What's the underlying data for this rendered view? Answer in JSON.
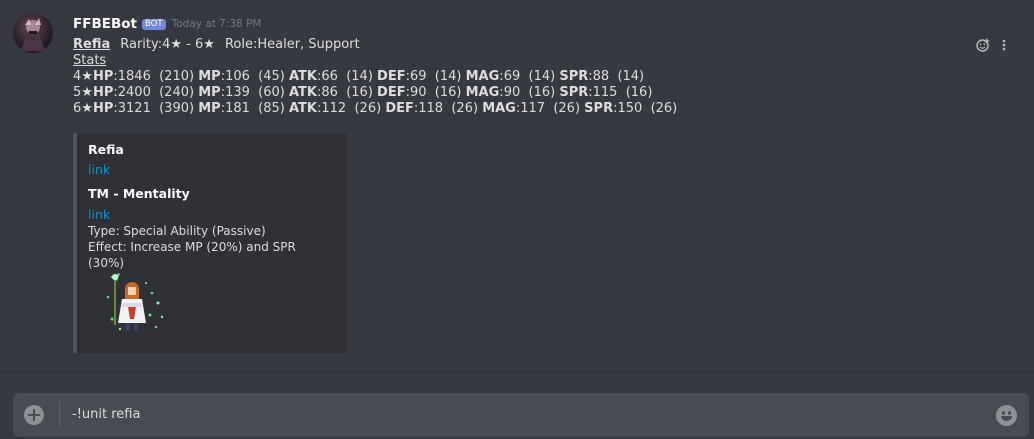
{
  "message": {
    "username": "FFBEBot",
    "bot_tag": "BOT",
    "timestamp": "Today at 7:38 PM",
    "unit_name": "Refia",
    "rarity_text": "Rarity:4★ - 6★",
    "role_text": "Role:Healer, Support",
    "stats_label": "Stats",
    "stats_rows": [
      {
        "prefix": "4★",
        "hp": "1846",
        "hp_b": "(210)",
        "mp": "106",
        "mp_b": "(45)",
        "atk": "66",
        "atk_b": "(14)",
        "def": "69",
        "def_b": "(14)",
        "mag": "69",
        "mag_b": "(14)",
        "spr": "88",
        "spr_b": "(14)"
      },
      {
        "prefix": "5★",
        "hp": "2400",
        "hp_b": "(240)",
        "mp": "139",
        "mp_b": "(60)",
        "atk": "86",
        "atk_b": "(16)",
        "def": "90",
        "def_b": "(16)",
        "mag": "90",
        "mag_b": "(16)",
        "spr": "115",
        "spr_b": "(16)"
      },
      {
        "prefix": "6★",
        "hp": "3121",
        "hp_b": "(390)",
        "mp": "181",
        "mp_b": "(85)",
        "atk": "112",
        "atk_b": "(26)",
        "def": "118",
        "def_b": "(26)",
        "mag": "117",
        "mag_b": "(26)",
        "spr": "150",
        "spr_b": "(26)"
      }
    ],
    "stat_keys": {
      "hp": "HP",
      "mp": "MP",
      "atk": "ATK",
      "def": "DEF",
      "mag": "MAG",
      "spr": "SPR"
    }
  },
  "embed": {
    "title": "Refia",
    "link1": "link",
    "tm_title": "TM - Mentality",
    "link2": "link",
    "type_text": "Type:  Special Ability (Passive)",
    "effect_text": "Effect: Increase MP (20%) and SPR (30%)",
    "border_color": "#4f545c"
  },
  "composer": {
    "input_value": "-!unit refia"
  },
  "icons": {
    "add_reaction": "add-reaction-icon",
    "more": "more-options-icon",
    "plus": "plus-circle-icon",
    "emoji": "emoji-icon"
  },
  "colors": {
    "background": "#36393f",
    "embed_bg": "#2f3136",
    "bot_tag": "#7289da",
    "link": "#0096cf",
    "input_bg": "#484c52"
  }
}
